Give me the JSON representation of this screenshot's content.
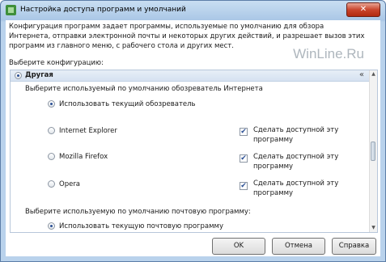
{
  "window": {
    "title": "Настройка доступа программ и умолчаний",
    "close_label": "✕"
  },
  "description": "Конфигурация программ задает программы, используемые по умолчанию для обзора Интернета, отправки электронной почты и некоторых других действий, и разрешает вызов этих программ из главного меню, с рабочего стола и других мест.",
  "watermark": "WinLine.Ru",
  "choose_config_label": "Выберите конфигурацию:",
  "section": {
    "title": "Другая",
    "browser_prompt": "Выберите используемый по умолчанию обозреватель Интернета",
    "browser_options": [
      {
        "label": "Использовать текущий обозреватель",
        "selected": true
      },
      {
        "label": "Internet Explorer",
        "selected": false,
        "checkbox_label_1": "Сделать доступной эту",
        "checkbox_label_2": "программу",
        "checked": true
      },
      {
        "label": "Mozilla Firefox",
        "selected": false,
        "checkbox_label_1": "Сделать доступной эту",
        "checkbox_label_2": "программу",
        "checked": true
      },
      {
        "label": "Opera",
        "selected": false,
        "checkbox_label_1": "Сделать доступной эту",
        "checkbox_label_2": "программу",
        "checked": true
      }
    ],
    "mail_prompt": "Выберите используемую по умолчанию почтовую программу:",
    "mail_current_option": "Использовать текущую почтовую программу"
  },
  "buttons": {
    "ok": "OK",
    "cancel": "Отмена",
    "help": "Справка"
  },
  "icons": {
    "check_glyph": "✔",
    "collapse": "«",
    "scroll_up": "▲",
    "scroll_down": "▼"
  }
}
